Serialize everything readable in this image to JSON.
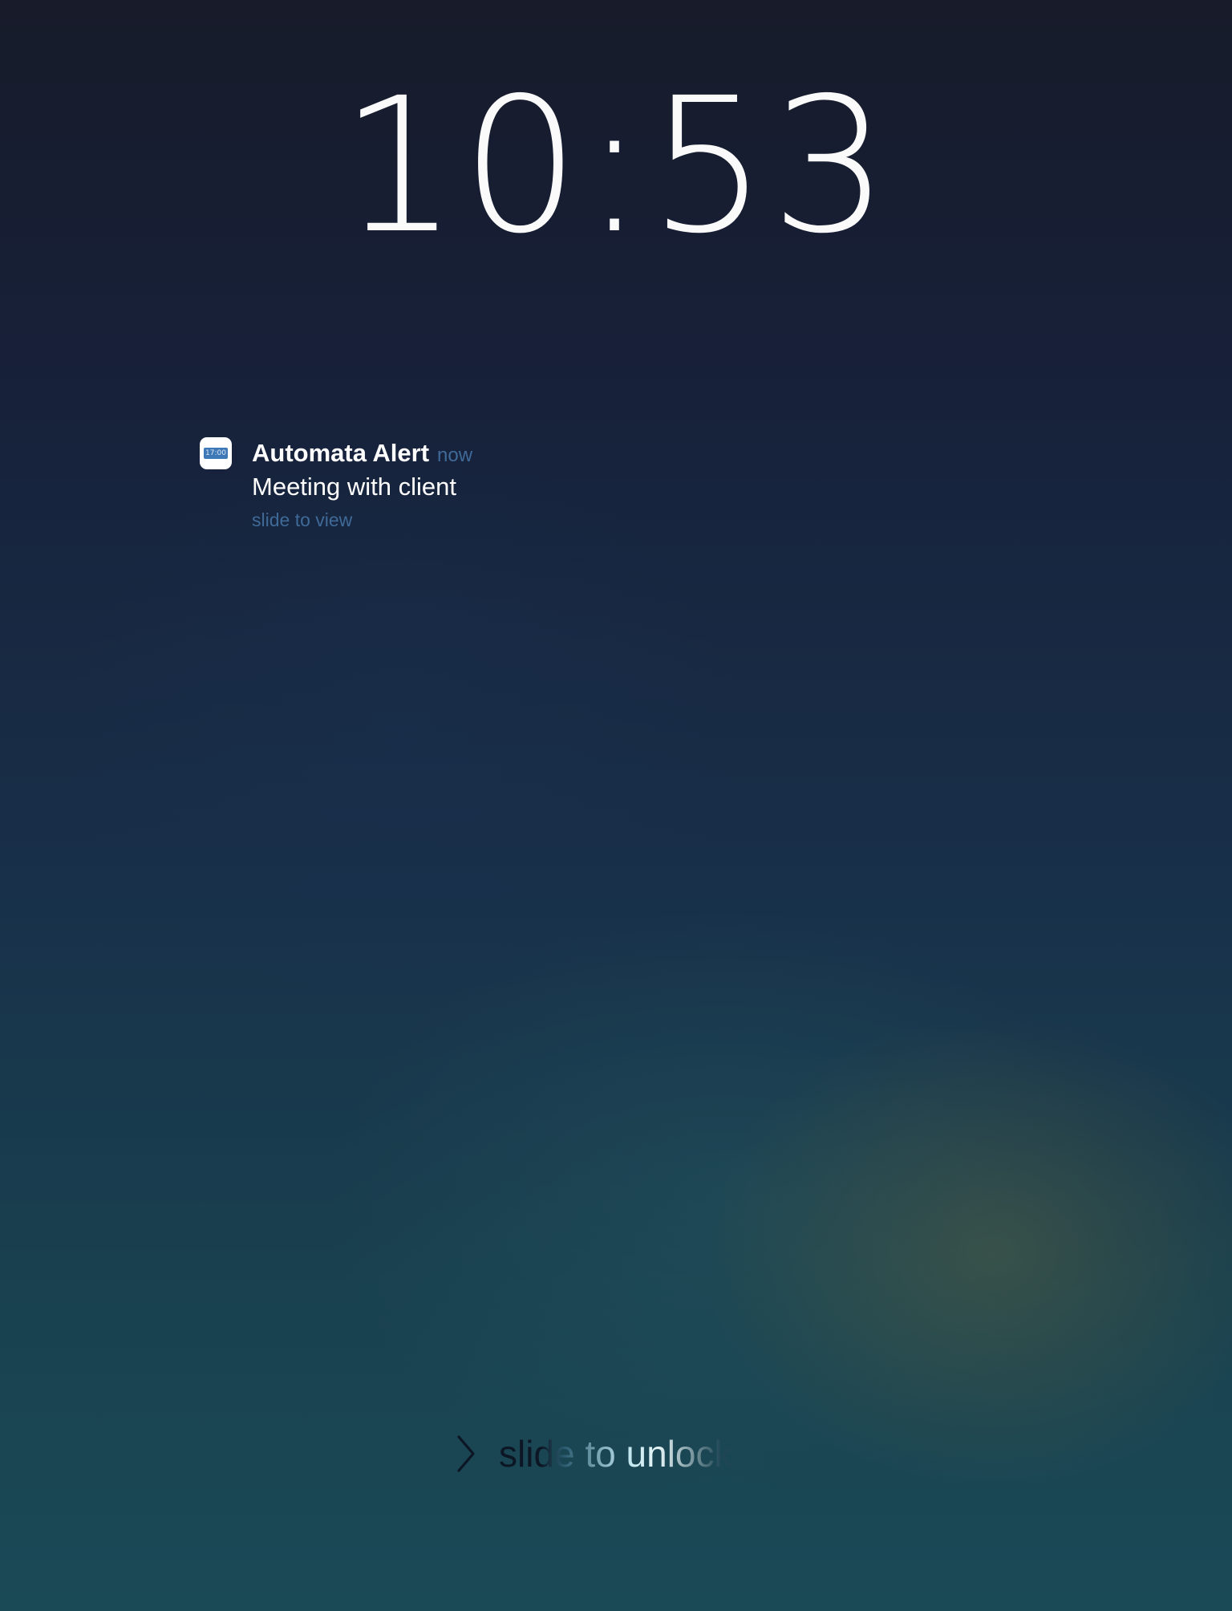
{
  "lockscreen": {
    "time": "10:53"
  },
  "notification": {
    "app_icon": "calendar-clock-icon",
    "icon_text": "17:00",
    "app_name": "Automata Alert",
    "timestamp": "now",
    "message": "Meeting with client",
    "action_hint": "slide to view"
  },
  "unlock": {
    "icon": "chevron-right-icon",
    "label": "slide to unlock"
  },
  "colors": {
    "background_top": "#171b2a",
    "background_bottom": "#1b4a57",
    "accent_text": "#3f6a98",
    "icon_blue": "#3e78b6"
  }
}
